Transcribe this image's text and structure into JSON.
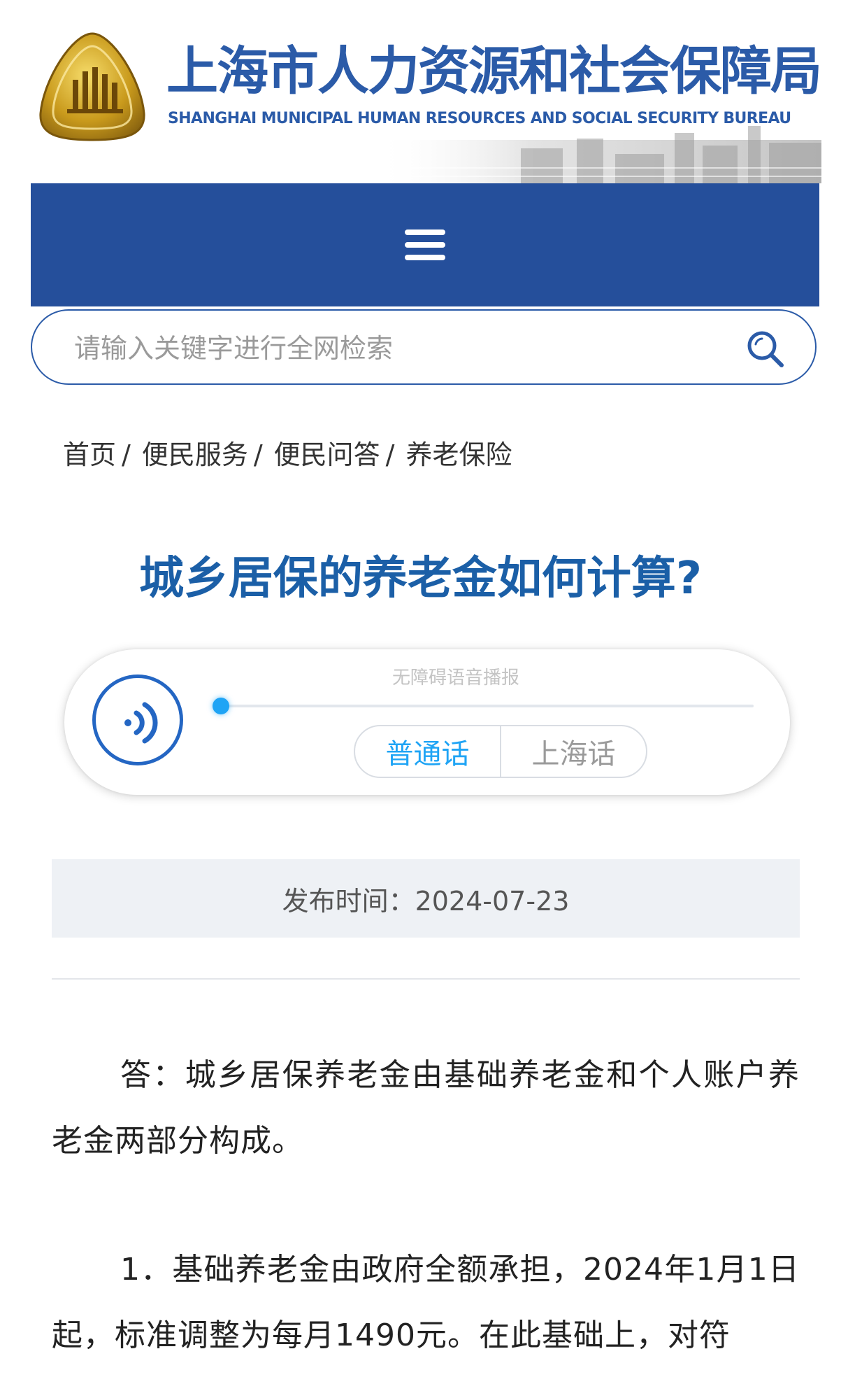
{
  "header": {
    "title_cn": "上海市人力资源和社会保障局",
    "title_en": "SHANGHAI MUNICIPAL HUMAN RESOURCES AND SOCIAL SECURITY BUREAU",
    "emblem": "shanghai-emblem-logo",
    "brand_color": "#2b5ba8"
  },
  "nav": {
    "menu_icon": "hamburger-menu-icon",
    "bg_color": "#254f9b"
  },
  "search": {
    "placeholder": "请输入关键字进行全网检索",
    "icon": "search-icon"
  },
  "breadcrumb": {
    "items": [
      {
        "label": "首页"
      },
      {
        "label": "便民服务"
      },
      {
        "label": "便民问答"
      },
      {
        "label": "养老保险"
      }
    ],
    "separator": "/"
  },
  "article": {
    "title": "城乡居保的养老金如何计算?",
    "publish_label": "发布时间：2024-07-23",
    "paragraphs": [
      "答：城乡居保养老金由基础养老金和个人账户养老金两部分构成。",
      "1．基础养老金由政府全额承担，2024年1月1日起，标准调整为每月1490元。在此基础上，对符"
    ]
  },
  "player": {
    "caption": "无障碍语音播报",
    "play_icon": "speaker-sound-icon",
    "progress": 0,
    "languages": [
      {
        "label": "普通话",
        "active": true
      },
      {
        "label": "上海话",
        "active": false
      }
    ],
    "accent_color": "#1fa4f5"
  }
}
